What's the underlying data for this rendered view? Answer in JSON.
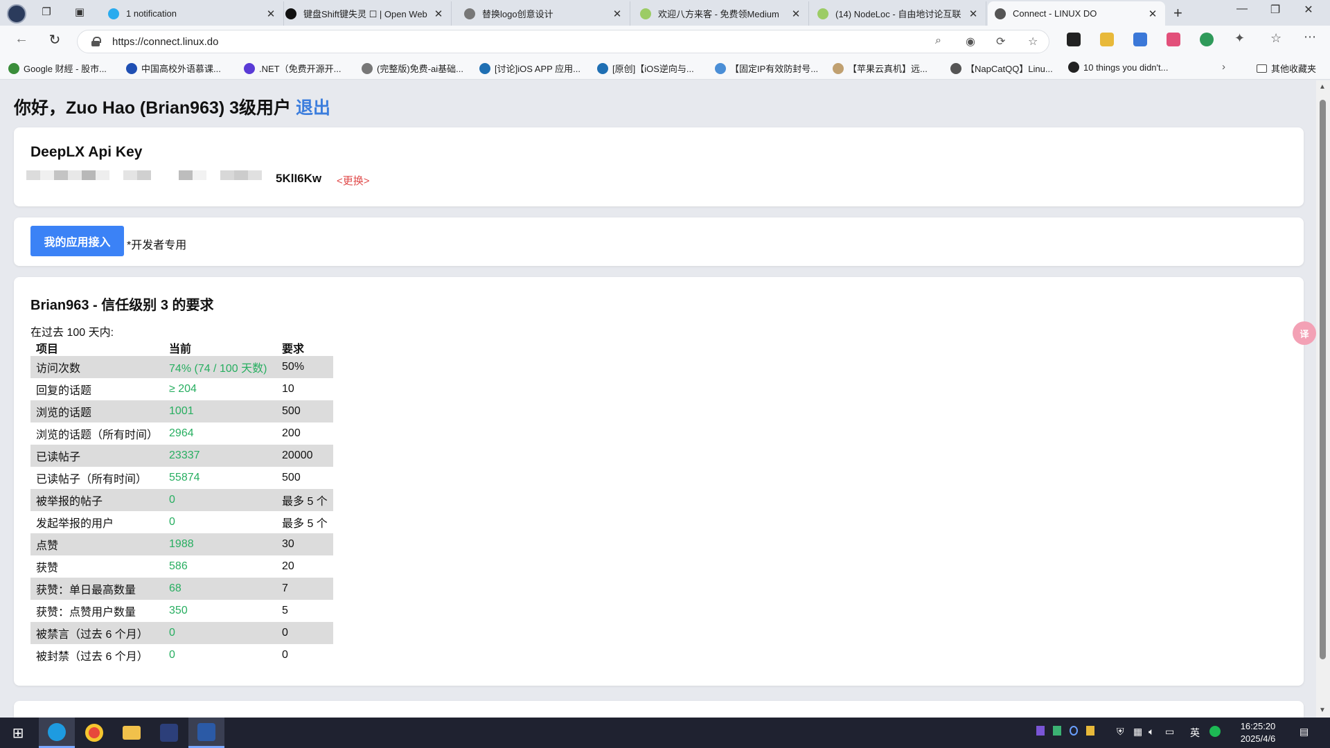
{
  "browser": {
    "tabs": [
      {
        "title": "1 notification",
        "favicon": "telegram-icon",
        "color": "#2aabee"
      },
      {
        "title": "键盘Shift键失灵 ☐ | Open Web",
        "favicon": "openwebui-icon",
        "color": "#111111"
      },
      {
        "title": "替换logo创意设计",
        "favicon": "openai-icon",
        "color": "#777777"
      },
      {
        "title": "欢迎八方来客 - 免费领Medium",
        "favicon": "nodeloc-icon",
        "color": "#9ccc65"
      },
      {
        "title": "(14) NodeLoc - 自由地讨论互联",
        "favicon": "nodeloc-icon",
        "color": "#9ccc65"
      },
      {
        "title": "Connect - LINUX DO",
        "favicon": "globe-icon",
        "color": "#555555"
      }
    ],
    "url": "https://connect.linux.do",
    "bookmarks": [
      "Google 财經 - 股市...",
      "中国高校外语慕课...",
      ".NET（免费开源开...",
      "(完整版)免费-ai基础...",
      "[讨论]iOS APP 应用...",
      "[原创]【iOS逆向与...",
      "【固定IP有效防封号...",
      "【苹果云真机】远...",
      "【NapCatQQ】Linu...",
      "10 things you didn't..."
    ],
    "other_bookmarks": "其他收藏夹"
  },
  "page": {
    "greeting": "你好，Zuo Hao (Brian963) 3级用户",
    "logout": "退出",
    "apikey_title": "DeepLX Api Key",
    "apikey_suffix": "5KlI6Kw",
    "change_link": "<更换>",
    "app_button": "我的应用接入",
    "dev_note": "*开发者专用",
    "req_title": "Brian963 - 信任级别 3 的要求",
    "period": "在过去 100 天内:",
    "headers": [
      "项目",
      "当前",
      "要求"
    ],
    "rows": [
      {
        "item": "访问次数",
        "current": "74% (74 / 100 天数)",
        "required": "50%"
      },
      {
        "item": "回复的话题",
        "current": "≥ 204",
        "required": "10"
      },
      {
        "item": "浏览的话题",
        "current": "1001",
        "required": "500"
      },
      {
        "item": "浏览的话题（所有时间）",
        "current": "2964",
        "required": "200"
      },
      {
        "item": "已读帖子",
        "current": "23337",
        "required": "20000"
      },
      {
        "item": "已读帖子（所有时间）",
        "current": "55874",
        "required": "500"
      },
      {
        "item": "被举报的帖子",
        "current": "0",
        "required": "最多 5 个"
      },
      {
        "item": "发起举报的用户",
        "current": "0",
        "required": "最多 5 个"
      },
      {
        "item": "点赞",
        "current": "1988",
        "required": "30"
      },
      {
        "item": "获赞",
        "current": "586",
        "required": "20"
      },
      {
        "item": "获赞：单日最高数量",
        "current": "68",
        "required": "7"
      },
      {
        "item": "获赞：点赞用户数量",
        "current": "350",
        "required": "5"
      },
      {
        "item": "被禁言（过去 6 个月）",
        "current": "0",
        "required": "0"
      },
      {
        "item": "被封禁（过去 6 个月）",
        "current": "0",
        "required": "0"
      }
    ]
  },
  "taskbar": {
    "time": "16:25:20",
    "date": "2025/4/6",
    "ime": "英"
  }
}
